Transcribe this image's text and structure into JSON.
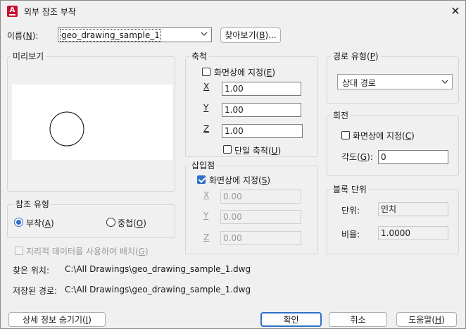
{
  "window": {
    "title": "외부 참조 부착",
    "close_glyph": "✕",
    "app_icon_letter": "A"
  },
  "name": {
    "label_prefix": "이름(",
    "label_key": "N",
    "label_suffix": "):",
    "value": "geo_drawing_sample_1",
    "browse_label_prefix": "찾아보기(",
    "browse_label_key": "B",
    "browse_label_suffix": ")..."
  },
  "preview": {
    "title": "미리보기"
  },
  "scale": {
    "title": "축척",
    "specify_prefix": "화면상에 지정(",
    "specify_key": "E",
    "specify_suffix": ")",
    "specify_checked": false,
    "x_label": "X",
    "y_label": "Y",
    "z_label": "Z",
    "x": "1.00",
    "y": "1.00",
    "z": "1.00",
    "uniform_prefix": "단일 축척(",
    "uniform_key": "U",
    "uniform_suffix": ")",
    "uniform_checked": false
  },
  "insertion": {
    "title": "삽입점",
    "specify_prefix": "화면상에 지정(",
    "specify_key": "S",
    "specify_suffix": ")",
    "specify_checked": true,
    "x_label": "X",
    "y_label": "Y",
    "z_label": "Z",
    "x": "0.00",
    "y": "0.00",
    "z": "0.00"
  },
  "path_type": {
    "title_prefix": "경로 유형(",
    "title_key": "P",
    "title_suffix": ")",
    "value": "상대 경로"
  },
  "rotation": {
    "title": "회전",
    "specify_prefix": "화면상에 지정(",
    "specify_key": "C",
    "specify_suffix": ")",
    "specify_checked": false,
    "angle_prefix": "각도(",
    "angle_key": "G",
    "angle_suffix": "):",
    "angle": "0"
  },
  "block_unit": {
    "title": "블록 단위",
    "unit_label": "단위:",
    "unit_value": "인치",
    "factor_label": "비율:",
    "factor_value": "1.0000"
  },
  "reference_type": {
    "title": "참조 유형",
    "attach_prefix": "부착(",
    "attach_key": "A",
    "attach_suffix": ")",
    "overlay_prefix": "중첩(",
    "overlay_key": "O",
    "overlay_suffix": ")",
    "selected": "attach"
  },
  "geo": {
    "label_prefix": "지리적 데이터를 사용하여 배치(",
    "label_key": "G",
    "label_suffix": ")",
    "checked": false
  },
  "info": {
    "found_label": "찾은 위치:",
    "found_path": "C:\\All Drawings\\geo_drawing_sample_1.dwg",
    "saved_label": "저장된 경로:",
    "saved_path": "C:\\All Drawings\\geo_drawing_sample_1.dwg"
  },
  "buttons": {
    "details_prefix": "상세 정보 숨기기(",
    "details_key": "I",
    "details_suffix": ")",
    "ok": "확인",
    "cancel": "취소",
    "help_prefix": "도움말(",
    "help_key": "H",
    "help_suffix": ")"
  },
  "colors": {
    "accent": "#2f6fc9",
    "app_icon": "#c8102e"
  }
}
